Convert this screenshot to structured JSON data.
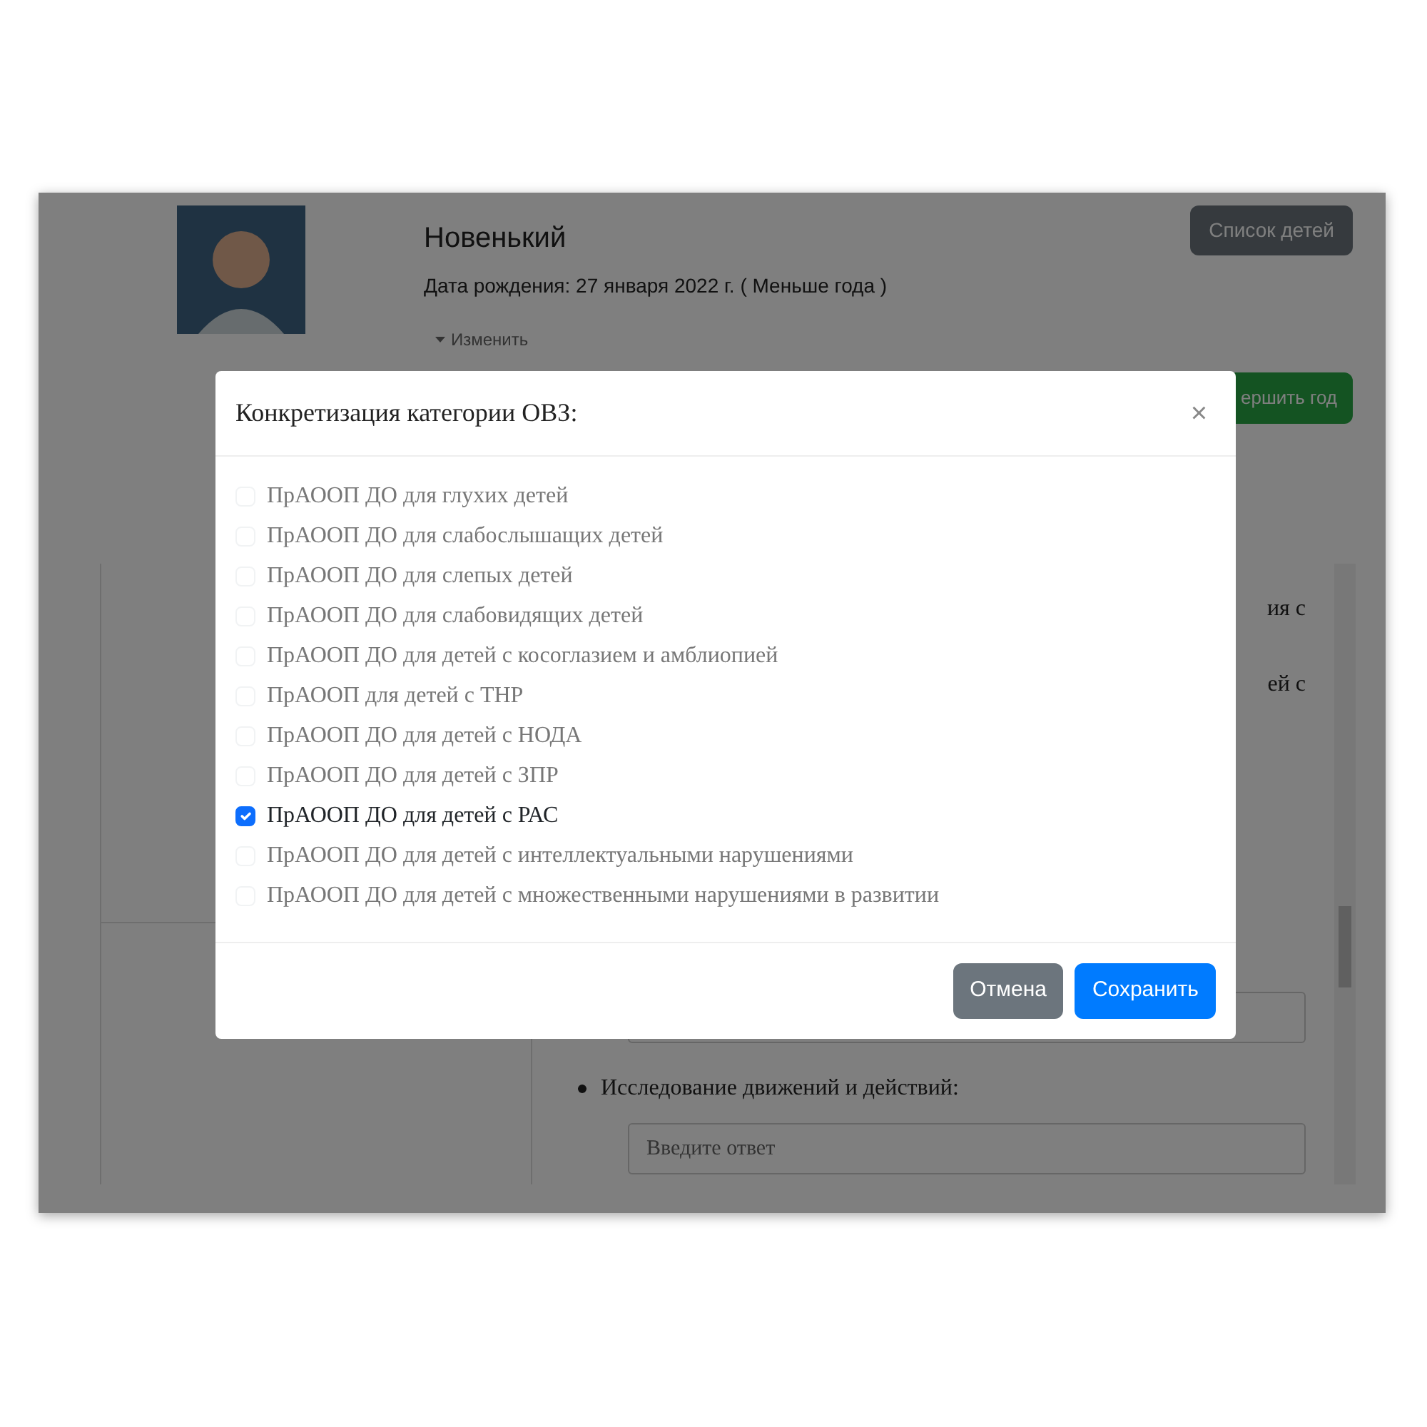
{
  "page": {
    "child": {
      "name": "Новенький",
      "birth_line": "Дата рождения: 27 января 2022 г. ( Меньше года )",
      "edit_link": "Изменить"
    },
    "children_list_button": "Список детей",
    "year_button": "ершить год",
    "fragments": [
      "ия с",
      "ей с"
    ],
    "questions": [
      {
        "label": "Исследование движений и действий:",
        "placeholder": "Введите ответ"
      }
    ]
  },
  "modal": {
    "title": "Конкретизация категории ОВЗ:",
    "close": "×",
    "options": [
      {
        "label": "ПрАООП ДО для глухих детей",
        "checked": false,
        "disabled": true
      },
      {
        "label": "ПрАООП ДО для слабослышащих детей",
        "checked": false,
        "disabled": true
      },
      {
        "label": "ПрАООП ДО для слепых детей",
        "checked": false,
        "disabled": true
      },
      {
        "label": "ПрАООП ДО для слабовидящих детей",
        "checked": false,
        "disabled": true
      },
      {
        "label": "ПрАООП ДО для детей с косоглазием и амблиопией",
        "checked": false,
        "disabled": true
      },
      {
        "label": "ПрАООП для детей с ТНР",
        "checked": false,
        "disabled": true
      },
      {
        "label": "ПрАООП ДО для детей с НОДА",
        "checked": false,
        "disabled": true
      },
      {
        "label": "ПрАООП ДО для детей с ЗПР",
        "checked": false,
        "disabled": true
      },
      {
        "label": "ПрАООП ДО для детей с РАС",
        "checked": true,
        "disabled": false
      },
      {
        "label": "ПрАООП ДО для детей с интеллектуальными нарушениями",
        "checked": false,
        "disabled": true
      },
      {
        "label": "ПрАООП ДО для детей с множественными нарушениями в развитии",
        "checked": false,
        "disabled": true
      }
    ],
    "buttons": [
      {
        "label": "Отмена",
        "kind": "secondary"
      },
      {
        "label": "Сохранить",
        "kind": "primary"
      }
    ]
  }
}
